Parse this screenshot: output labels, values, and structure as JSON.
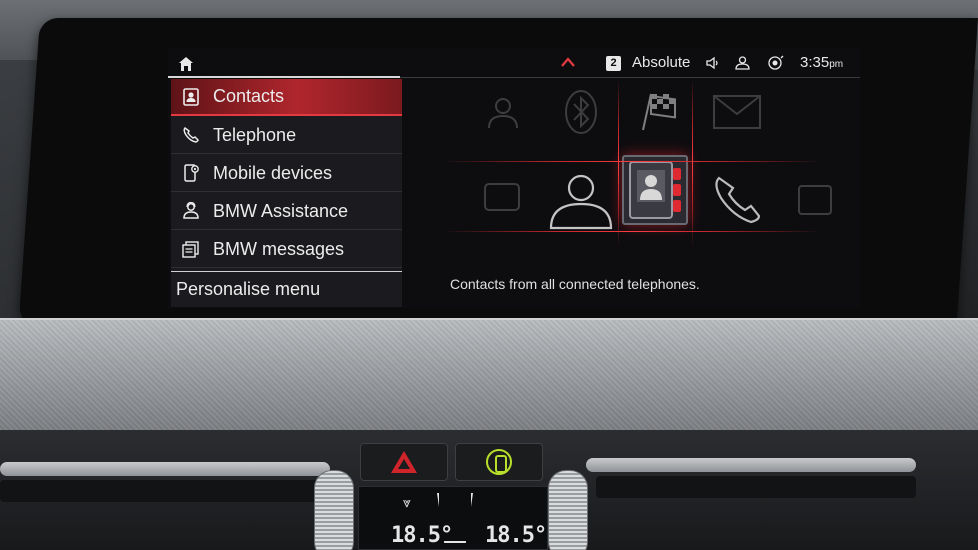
{
  "status": {
    "radio_preset": "2",
    "station": "Absolute",
    "time": "3:35",
    "ampm": "pm"
  },
  "menu": {
    "items": [
      {
        "label": "Contacts",
        "icon": "contacts-icon",
        "selected": true
      },
      {
        "label": "Telephone",
        "icon": "telephone-icon",
        "selected": false
      },
      {
        "label": "Mobile devices",
        "icon": "mobile-devices-icon",
        "selected": false
      },
      {
        "label": "BMW Assistance",
        "icon": "assistance-icon",
        "selected": false
      },
      {
        "label": "BMW messages",
        "icon": "messages-icon",
        "selected": false
      }
    ],
    "personalise": "Personalise menu"
  },
  "content": {
    "description": "Contacts from all connected telephones."
  },
  "climate": {
    "left_temp": "18.5°",
    "right_temp": "18.5°"
  },
  "colors": {
    "accent": "#b0262d",
    "accent_glow": "#ff3b42",
    "text": "#ececec",
    "pdc_green": "#b8e02a",
    "hazard_red": "#d0242b"
  }
}
